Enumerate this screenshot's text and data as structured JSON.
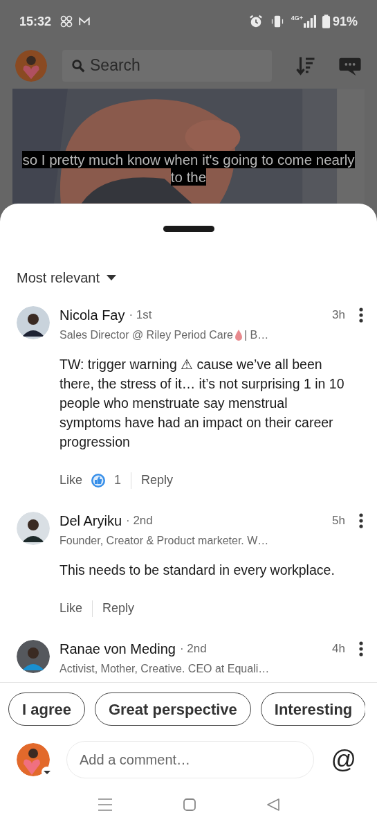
{
  "status_bar": {
    "time": "15:32",
    "network": "4G+",
    "battery": "91%"
  },
  "header": {
    "search": {
      "placeholder": "Search"
    }
  },
  "video": {
    "caption_lines": [
      "so I pretty much know when it's going to come nearly",
      "to the"
    ]
  },
  "sort": {
    "label": "Most relevant"
  },
  "comments": [
    {
      "name": "Nicola Fay",
      "degree": "· 1st",
      "time": "3h",
      "headline": "Sales Director @ Riley Period Care",
      "headline_tail": "| B…",
      "body": "TW: trigger warning ⚠ cause we’ve all been there, the stress of it… it’s not surprising 1 in 10 people who menstruate say menstrual symptoms have had an impact on their career progression",
      "like": "Like",
      "reactions": "1",
      "reply": "Reply"
    },
    {
      "name": "Del Aryiku",
      "degree": "· 2nd",
      "time": "5h",
      "headline": "Founder, Creator & Product marketer. W…",
      "body": "This needs to be standard in every workplace.",
      "like": "Like",
      "reply": "Reply"
    },
    {
      "name": "Ranae von Meding",
      "degree": "· 2nd",
      "time": "4h",
      "headline": "Activist, Mother, Creative. CEO at Equali…"
    }
  ],
  "quick_replies": [
    "I agree",
    "Great perspective",
    "Interesting"
  ],
  "composer": {
    "placeholder": "Add a comment…",
    "mention": "@"
  }
}
